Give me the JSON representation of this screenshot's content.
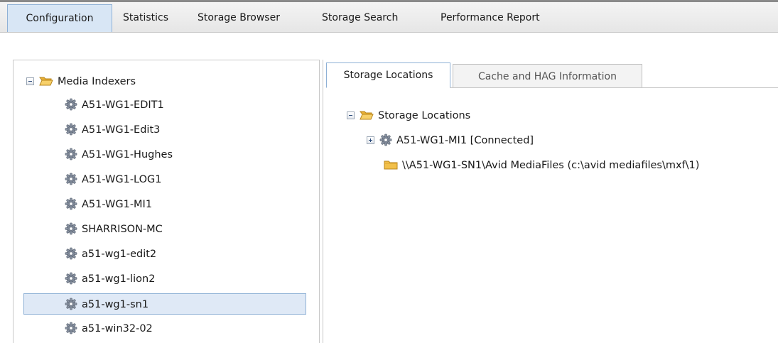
{
  "top_tabs": [
    {
      "label": "Configuration",
      "active": true
    },
    {
      "label": "Statistics",
      "active": false
    },
    {
      "label": "Storage Browser",
      "active": false
    },
    {
      "label": "Storage Search",
      "active": false
    },
    {
      "label": "Performance Report",
      "active": false
    }
  ],
  "left_tree": {
    "root": {
      "label": "Media Indexers",
      "expanded": true,
      "icon": "folder-open-icon"
    },
    "items": [
      {
        "label": "A51-WG1-EDIT1",
        "icon": "gear-icon",
        "selected": false
      },
      {
        "label": "A51-WG1-Edit3",
        "icon": "gear-icon",
        "selected": false
      },
      {
        "label": "A51-WG1-Hughes",
        "icon": "gear-icon",
        "selected": false
      },
      {
        "label": "A51-WG1-LOG1",
        "icon": "gear-icon",
        "selected": false
      },
      {
        "label": "A51-WG1-MI1",
        "icon": "gear-icon",
        "selected": false
      },
      {
        "label": "SHARRISON-MC",
        "icon": "gear-icon",
        "selected": false
      },
      {
        "label": "a51-wg1-edit2",
        "icon": "gear-icon",
        "selected": false
      },
      {
        "label": "a51-wg1-lion2",
        "icon": "gear-icon",
        "selected": false
      },
      {
        "label": "a51-wg1-sn1",
        "icon": "gear-icon",
        "selected": true
      },
      {
        "label": "a51-win32-02",
        "icon": "gear-icon",
        "selected": false
      }
    ]
  },
  "detail_tabs": [
    {
      "label": "Storage Locations",
      "active": true
    },
    {
      "label": "Cache and HAG Information",
      "active": false
    }
  ],
  "storage_tree": {
    "root": {
      "label": "Storage Locations",
      "expanded": true,
      "icon": "folder-open-icon"
    },
    "node": {
      "label": "A51-WG1-MI1 [Connected]",
      "expanded": false,
      "icon": "gear-icon"
    },
    "location": {
      "label": "\\\\A51-WG1-SN1\\Avid MediaFiles (c:\\avid mediafiles\\mxf\\1)",
      "icon": "folder-icon"
    }
  },
  "colors": {
    "selection_bg": "#dfe9f6",
    "selection_border": "#8fb1d6",
    "folder": "#f2c04a"
  }
}
